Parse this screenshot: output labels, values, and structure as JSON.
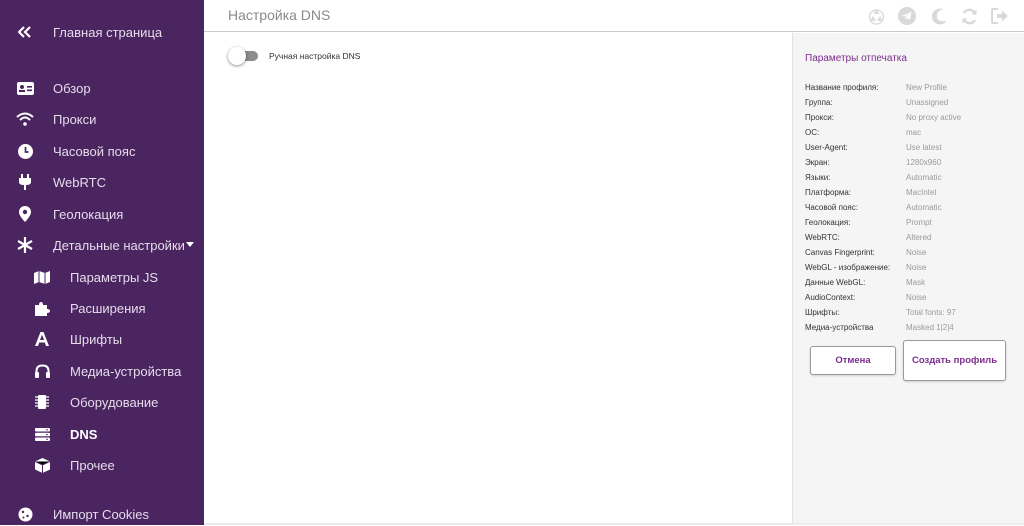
{
  "sidebar": {
    "home": "Главная страница",
    "items": [
      {
        "label": "Обзор",
        "icon": "id-card-icon"
      },
      {
        "label": "Прокси",
        "icon": "wifi-icon"
      },
      {
        "label": "Часовой пояс",
        "icon": "clock-icon"
      },
      {
        "label": "WebRTC",
        "icon": "plug-icon"
      },
      {
        "label": "Геолокация",
        "icon": "map-marker-icon"
      },
      {
        "label": "Детальные настройки",
        "icon": "asterisk-icon"
      }
    ],
    "subitems": [
      {
        "label": "Параметры JS",
        "icon": "map-icon"
      },
      {
        "label": "Расширения",
        "icon": "puzzle-icon"
      },
      {
        "label": "Шрифты",
        "icon": "font-icon"
      },
      {
        "label": "Медиа-устройства",
        "icon": "headphones-icon"
      },
      {
        "label": "Оборудование",
        "icon": "chip-icon"
      },
      {
        "label": "DNS",
        "icon": "server-icon"
      },
      {
        "label": "Прочее",
        "icon": "cube-icon"
      }
    ],
    "cookies": "Импорт Cookies",
    "active": "DNS"
  },
  "header": {
    "title": "Настройка DNS",
    "icons": [
      "recycle-icon",
      "telegram-icon",
      "moon-icon",
      "refresh-icon",
      "logout-icon"
    ]
  },
  "main": {
    "toggle_label": "Ручная настройка DNS",
    "toggle_on": false
  },
  "panel": {
    "title": "Параметры отпечатка",
    "rows": [
      {
        "key": "Название профиля:",
        "value": "New Profile"
      },
      {
        "key": "Группа:",
        "value": "Unassigned"
      },
      {
        "key": "Прокси:",
        "value": "No proxy active"
      },
      {
        "key": "ОС:",
        "value": "mac"
      },
      {
        "key": "User-Agent:",
        "value": "Use latest"
      },
      {
        "key": "Экран:",
        "value": "1280x960"
      },
      {
        "key": "Языки:",
        "value": "Automatic"
      },
      {
        "key": "Платформа:",
        "value": "MacIntel"
      },
      {
        "key": "Часовой пояс:",
        "value": "Automatic"
      },
      {
        "key": "Геолокация:",
        "value": "Prompt"
      },
      {
        "key": "WebRTC:",
        "value": "Altered"
      },
      {
        "key": "Canvas Fingerprint:",
        "value": "Noise"
      },
      {
        "key": "WebGL - изображение:",
        "value": "Noise"
      },
      {
        "key": "Данные WebGL:",
        "value": "Mask"
      },
      {
        "key": "AudioContext:",
        "value": "Noise"
      },
      {
        "key": "Шрифты:",
        "value": "Total fonts: 97"
      },
      {
        "key": "Медиа-устройства",
        "value": "Masked 1|2|4"
      }
    ],
    "cancel": "Отмена",
    "create": "Создать профиль"
  },
  "colors": {
    "sidebar_bg": "#4a2560",
    "accent": "#7b2d8e",
    "panel_bg": "#f5f5f5"
  }
}
